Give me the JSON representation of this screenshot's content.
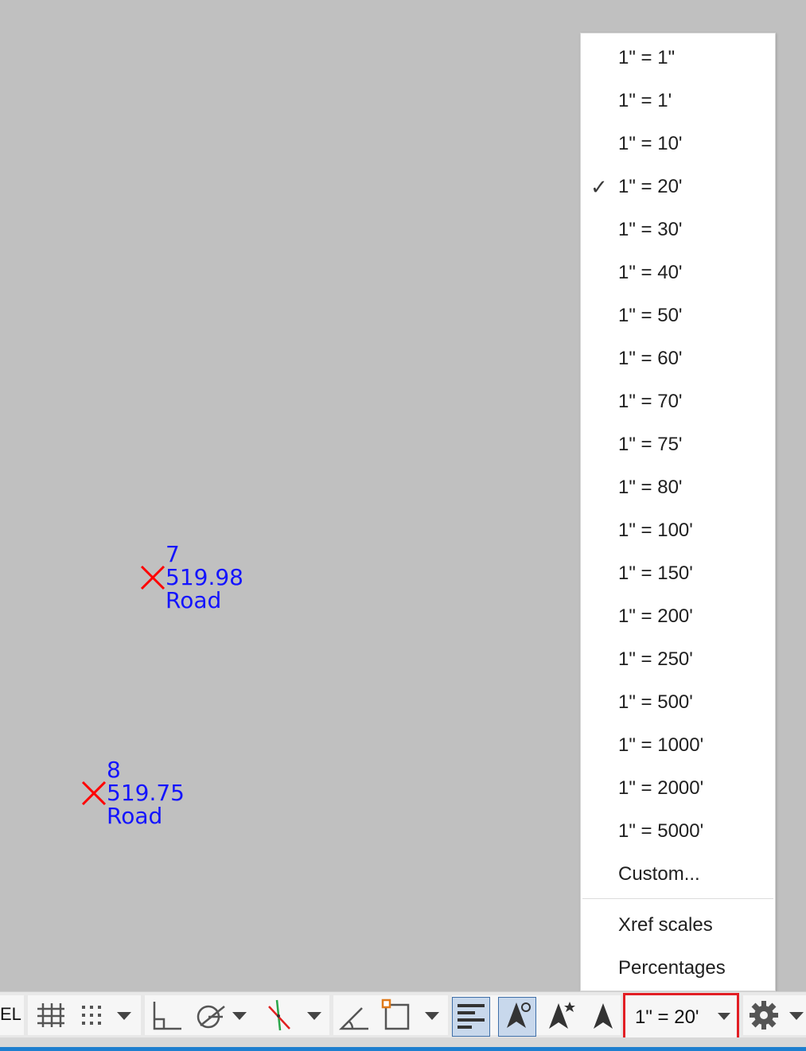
{
  "drawing": {
    "points": [
      {
        "number": "7",
        "elevation": "519.98",
        "description": "Road"
      },
      {
        "number": "8",
        "elevation": "519.75",
        "description": "Road"
      }
    ],
    "colors": {
      "marker": "#ff0000",
      "label": "#1414ff",
      "background": "#c0c0c0"
    }
  },
  "scale_menu": {
    "items": [
      {
        "label": "1\" = 1\"",
        "checked": false
      },
      {
        "label": "1\" = 1'",
        "checked": false
      },
      {
        "label": "1\" = 10'",
        "checked": false
      },
      {
        "label": "1\" = 20'",
        "checked": true
      },
      {
        "label": "1\" = 30'",
        "checked": false
      },
      {
        "label": "1\" = 40'",
        "checked": false
      },
      {
        "label": "1\" = 50'",
        "checked": false
      },
      {
        "label": "1\" = 60'",
        "checked": false
      },
      {
        "label": "1\" = 70'",
        "checked": false
      },
      {
        "label": "1\" = 75'",
        "checked": false
      },
      {
        "label": "1\" = 80'",
        "checked": false
      },
      {
        "label": "1\" = 100'",
        "checked": false
      },
      {
        "label": "1\" = 150'",
        "checked": false
      },
      {
        "label": "1\" = 200'",
        "checked": false
      },
      {
        "label": "1\" = 250'",
        "checked": false
      },
      {
        "label": "1\" = 500'",
        "checked": false
      },
      {
        "label": "1\" = 1000'",
        "checked": false
      },
      {
        "label": "1\" = 2000'",
        "checked": false
      },
      {
        "label": "1\" = 5000'",
        "checked": false
      },
      {
        "label": "Custom...",
        "checked": false
      }
    ],
    "footer_items": [
      "Xref scales",
      "Percentages"
    ],
    "check_mark": "✓"
  },
  "status_bar": {
    "model_label": "EL",
    "current_scale": "1\" = 20'",
    "icons": [
      "grid-icon",
      "snap-icon",
      "ortho-icon",
      "polar-icon",
      "osnap-track-icon",
      "isodraft-icon",
      "dynamic-ucs-icon",
      "lineweight-icon",
      "annotation-visibility-icon",
      "auto-scale-icon",
      "annotation-scale-icon",
      "gear-icon"
    ],
    "highlight_color": "#e21e24"
  }
}
